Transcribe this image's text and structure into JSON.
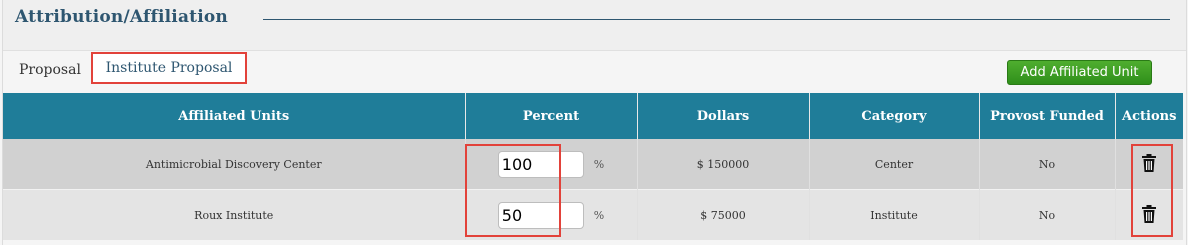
{
  "section": {
    "title": "Attribution/Affiliation"
  },
  "tabs": [
    {
      "label": "Proposal"
    },
    {
      "label": "Institute Proposal",
      "active": true
    }
  ],
  "add_button": {
    "label": "Add Affiliated Unit"
  },
  "table": {
    "headers": [
      "Affiliated Units",
      "Percent",
      "Dollars",
      "Category",
      "Provost Funded",
      "Actions"
    ],
    "rows": [
      {
        "unit": "Antimicrobial Discovery Center",
        "percent": "100",
        "percent_unit": "%",
        "dollars": "$ 150000",
        "category": "Center",
        "provost_funded": "No",
        "action_icon": "trash-icon"
      },
      {
        "unit": "Roux Institute",
        "percent": "50",
        "percent_unit": "%",
        "dollars": "$ 75000",
        "category": "Institute",
        "provost_funded": "No",
        "action_icon": "trash-icon"
      }
    ]
  },
  "colors": {
    "header_bg": "#1f7d99",
    "title": "#2e5670",
    "add_button": "#3a9d23",
    "highlight": "#e2423a",
    "row_odd": "#d1d1d1",
    "row_even": "#e4e4e4"
  }
}
